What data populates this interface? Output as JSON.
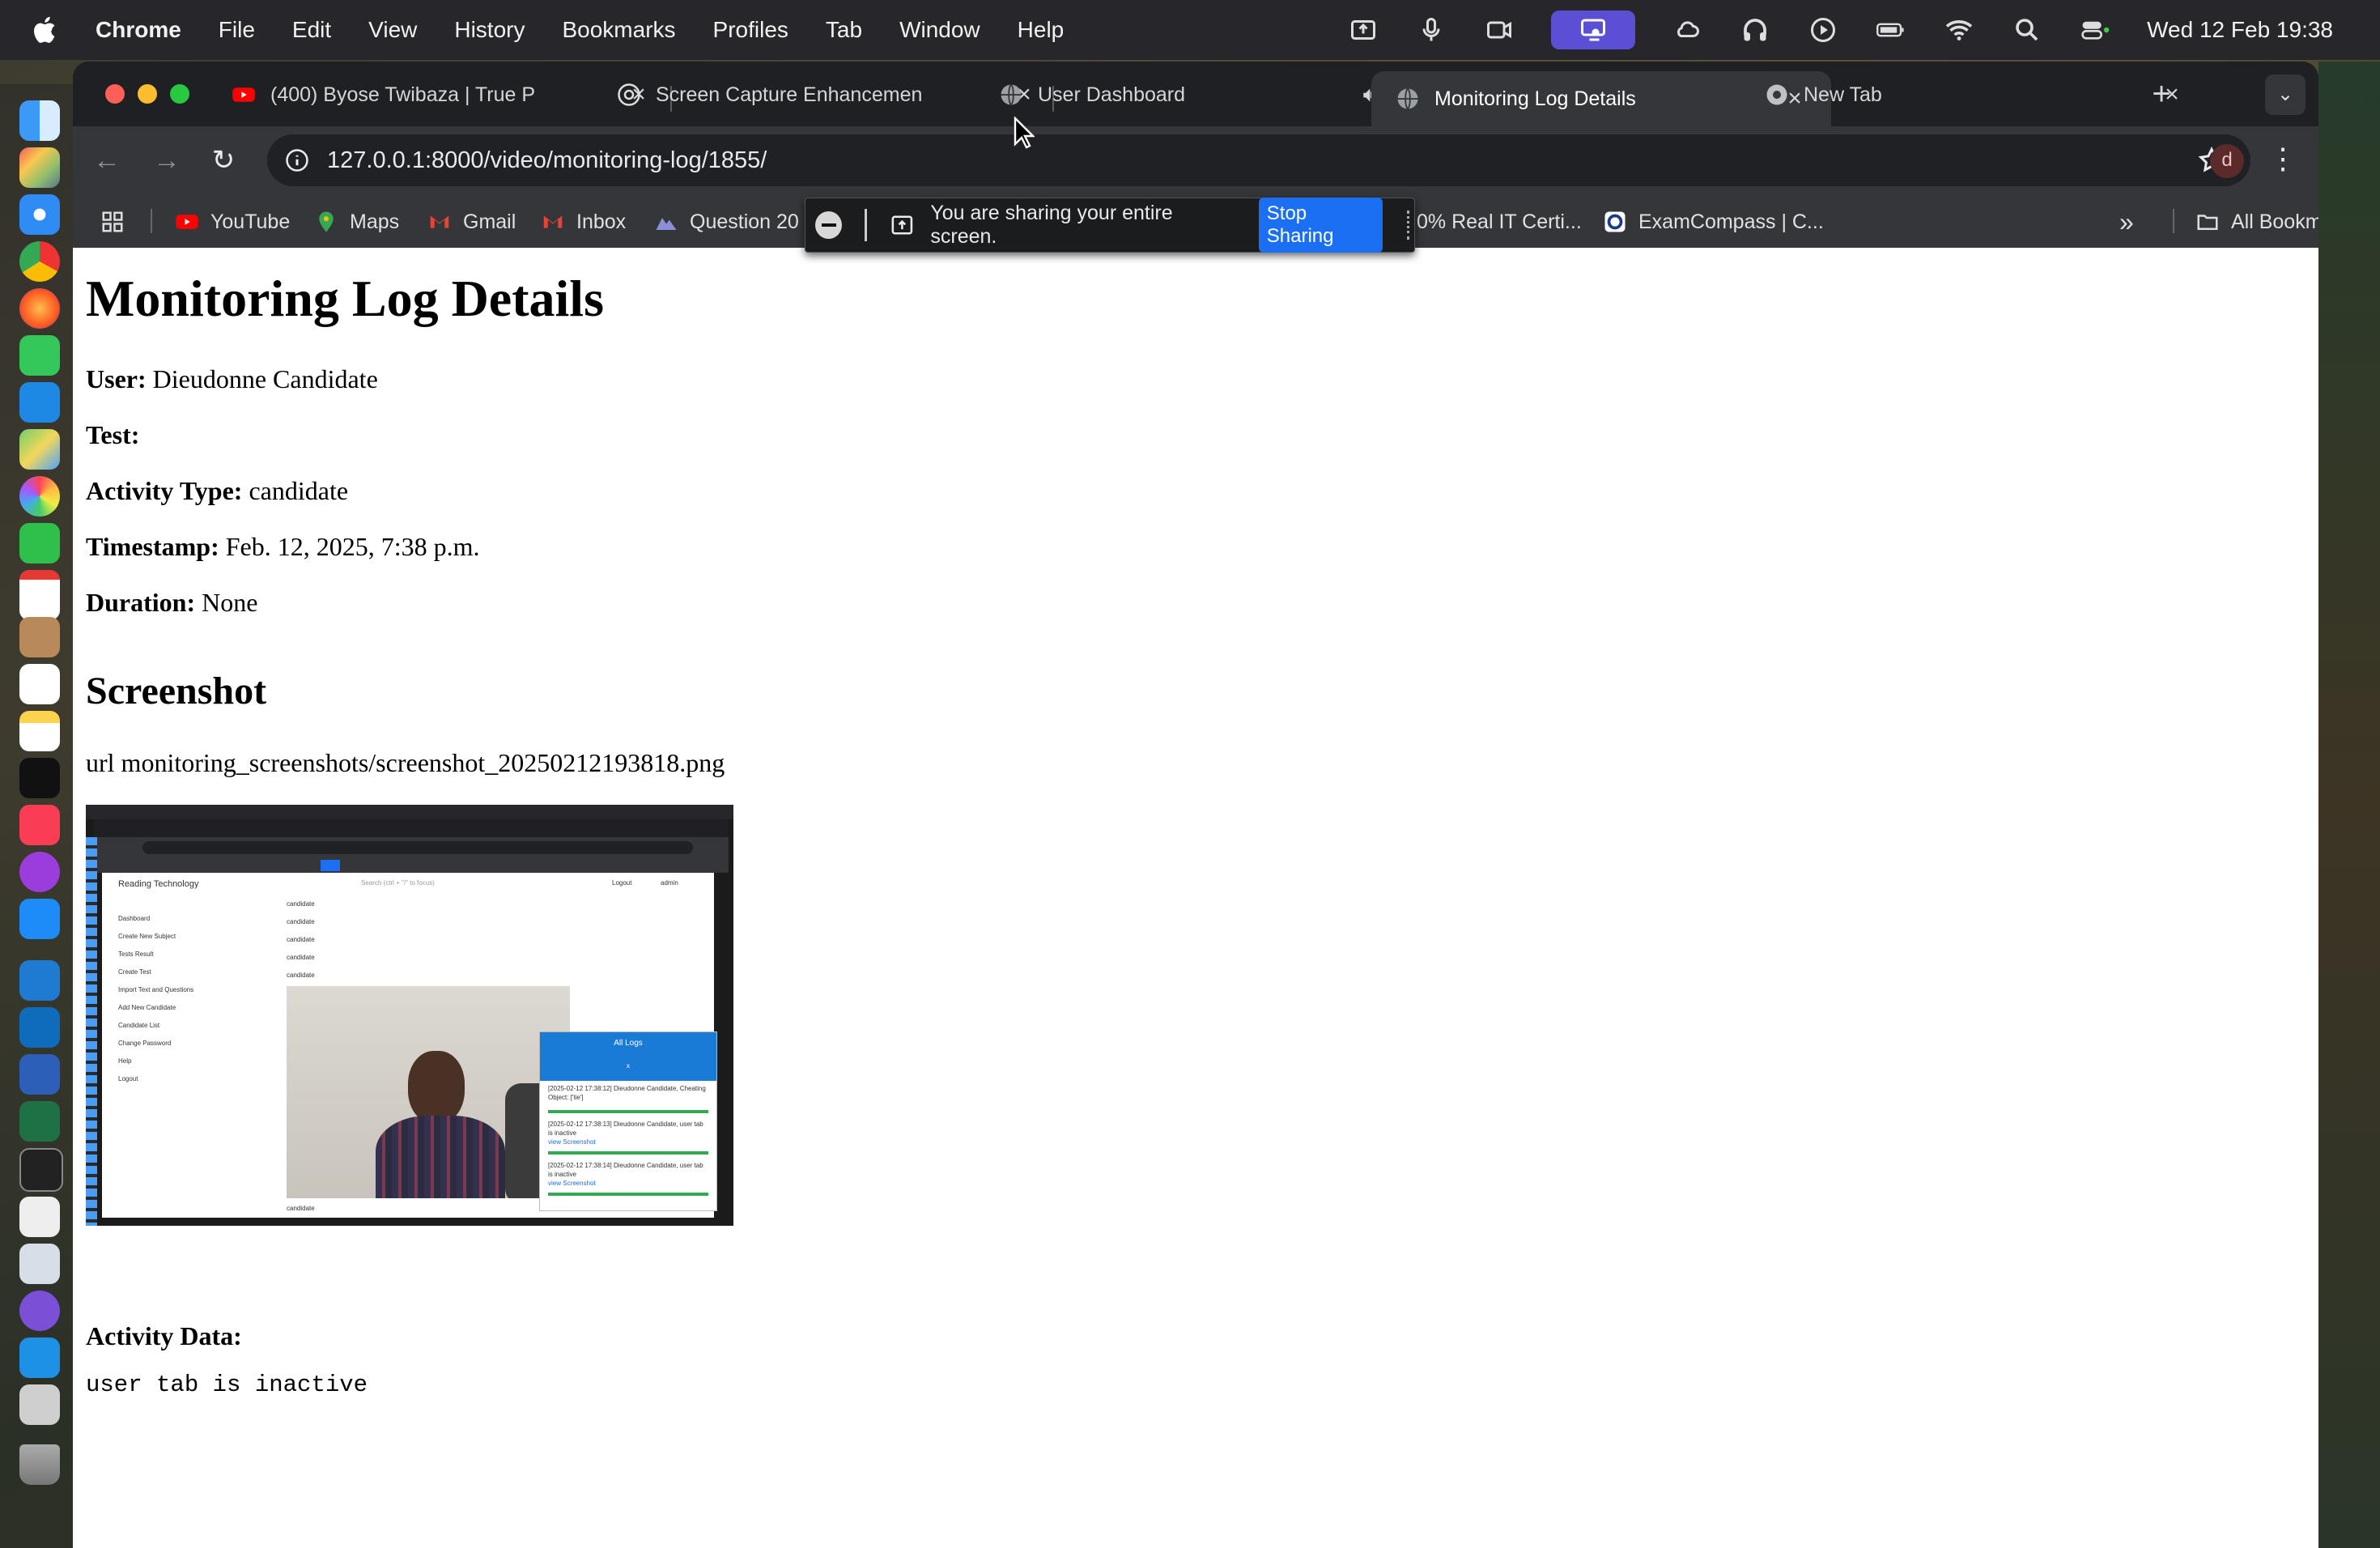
{
  "menubar": {
    "app": "Chrome",
    "items": [
      "File",
      "Edit",
      "View",
      "History",
      "Bookmarks",
      "Profiles",
      "Tab",
      "Window",
      "Help"
    ],
    "clock": "Wed 12 Feb  19:38"
  },
  "tabs": [
    {
      "title": "(400) Byose Twibaza | True P",
      "icon": "youtube-icon"
    },
    {
      "title": "Screen Capture Enhancemen",
      "icon": "openai-icon"
    },
    {
      "title": "User Dashboard",
      "icon": "globe-icon",
      "audio": true
    },
    {
      "title": "Monitoring Log Details",
      "icon": "globe-icon",
      "active": true
    },
    {
      "title": "New Tab",
      "icon": "chrome-icon"
    }
  ],
  "toolbar": {
    "url": "127.0.0.1:8000/video/monitoring-log/1855/",
    "profile_initial": "d"
  },
  "bookmarks": [
    {
      "label": "YouTube",
      "icon": "youtube-icon"
    },
    {
      "label": "Maps",
      "icon": "maps-icon"
    },
    {
      "label": "Gmail",
      "icon": "gmail-icon"
    },
    {
      "label": "Inbox",
      "icon": "gmail-icon"
    },
    {
      "label": "Question 20",
      "icon": "bookmark-icon"
    },
    {
      "label": "0% Real IT Certi...",
      "icon": "bookmark-icon"
    },
    {
      "label": "ExamCompass | C...",
      "icon": "examcompass-icon"
    }
  ],
  "all_bookmarks": "All Bookmarks",
  "sharebar": {
    "text": "You are sharing your entire screen.",
    "stop": "Stop Sharing"
  },
  "page": {
    "title": "Monitoring Log Details",
    "user_label": "User:",
    "user_value": "Dieudonne Candidate",
    "test_label": "Test:",
    "test_value": "",
    "activity_label": "Activity Type:",
    "activity_value": "candidate",
    "timestamp_label": "Timestamp:",
    "timestamp_value": "Feb. 12, 2025, 7:38 p.m.",
    "duration_label": "Duration:",
    "duration_value": "None",
    "screenshot_heading": "Screenshot",
    "screenshot_url": "url monitoring_screenshots/screenshot_20250212193818.png",
    "activity_data_label": "Activity Data:",
    "activity_data_value": "user tab is inactive"
  },
  "thumb": {
    "app_title": "Reading Technology",
    "search_placeholder": "Search (ctrl + \"/\" to focus)",
    "logout": "Logout",
    "admin": "admin",
    "sidebar": [
      "Dashboard",
      "Create New Subject",
      "Tests Result",
      "Create Test",
      "Import Text and Questions",
      "Add New Candidate",
      "Candidate List",
      "Change Password",
      "Help",
      "Logout"
    ],
    "list": [
      "candidate",
      "candidate",
      "candidate",
      "candidate",
      "candidate"
    ],
    "logs_title": "All Logs",
    "logs_close": "x",
    "logs": [
      "[2025-02-12 17:38:12] Dieudonne Candidate, Cheating Object: ['tie']",
      "[2025-02-12 17:38:13] Dieudonne Candidate, user tab is inactive",
      "[2025-02-12 17:38:14] Dieudonne Candidate, user tab is inactive"
    ],
    "view_screenshot": "view Screenshot",
    "footer_item": "candidate"
  }
}
